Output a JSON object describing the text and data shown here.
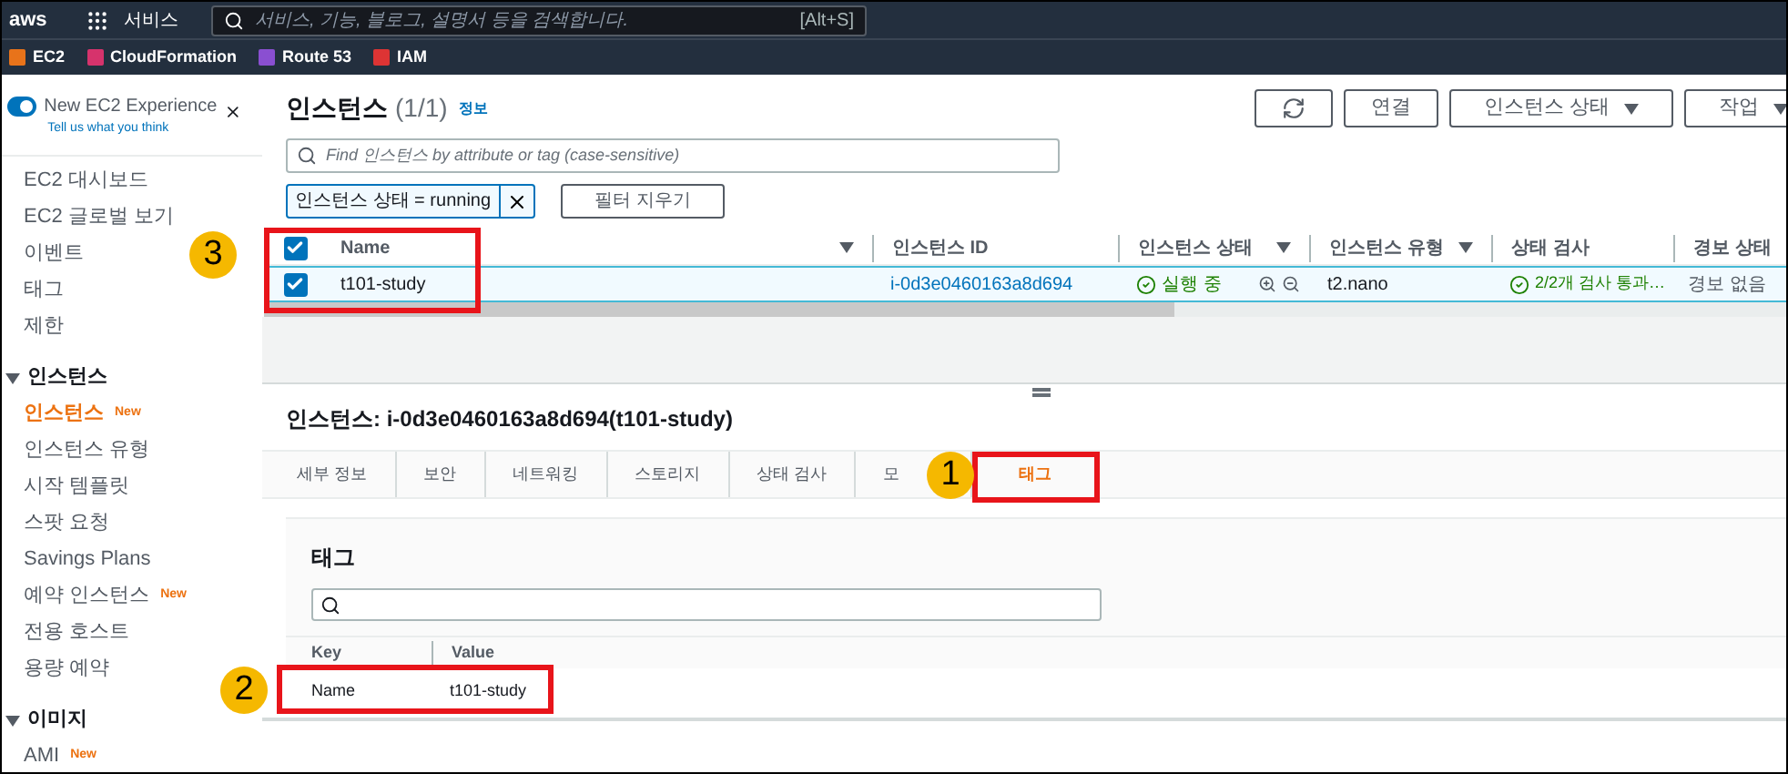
{
  "top_bar": {
    "logo": "aws",
    "services": "서비스",
    "search_placeholder": "서비스, 기능, 블로그, 설명서 등을 검색합니다.",
    "shortcut": "[Alt+S]"
  },
  "favorites": [
    {
      "label": "EC2",
      "color": "#e8731a"
    },
    {
      "label": "CloudFormation",
      "color": "#d6336c"
    },
    {
      "label": "Route 53",
      "color": "#8a4fd1"
    },
    {
      "label": "IAM",
      "color": "#dd3434"
    }
  ],
  "sidebar": {
    "experience": {
      "label": "New EC2 Experience",
      "link": "Tell us what you think",
      "on": true
    },
    "items": [
      {
        "label": "EC2 대시보드",
        "selected": false
      },
      {
        "label": "EC2 글로벌 보기",
        "selected": false
      },
      {
        "label": "이벤트",
        "selected": false
      },
      {
        "label": "태그",
        "selected": false
      },
      {
        "label": "제한",
        "selected": false
      }
    ],
    "sections": [
      {
        "title": "인스턴스",
        "expanded": true,
        "items": [
          {
            "label": "인스턴스",
            "selected": true,
            "badge": "New"
          },
          {
            "label": "인스턴스 유형",
            "selected": false
          },
          {
            "label": "시작 템플릿",
            "selected": false
          },
          {
            "label": "스팟 요청",
            "selected": false
          },
          {
            "label": "Savings Plans",
            "selected": false
          },
          {
            "label": "예약 인스턴스",
            "selected": false,
            "badge": "New"
          },
          {
            "label": "전용 호스트",
            "selected": false
          },
          {
            "label": "용량 예약",
            "selected": false
          }
        ]
      },
      {
        "title": "이미지",
        "expanded": true,
        "items": [
          {
            "label": "AMI",
            "selected": false,
            "badge": "New"
          }
        ]
      }
    ]
  },
  "instances": {
    "title": "인스턴스",
    "count": "(1/1)",
    "info": "정보",
    "buttons": [
      {
        "kind": "refresh"
      },
      {
        "label": "연결",
        "kind": "plain"
      },
      {
        "label": "인스턴스 상태",
        "kind": "dropdown"
      },
      {
        "label": "작업",
        "kind": "dropdown"
      }
    ],
    "search_placeholder": "Find 인스턴스 by attribute or tag (case-sensitive)",
    "filter_token": "인스턴스 상태 = running",
    "clear_filters": "필터 지우기"
  },
  "table": {
    "all_checked": true,
    "columns": [
      {
        "label": "Name",
        "sortable": true
      },
      {
        "label": "인스턴스 ID",
        "sortable": false
      },
      {
        "label": "인스턴스 상태",
        "sortable": true
      },
      {
        "label": "인스턴스 유형",
        "sortable": true
      },
      {
        "label": "상태 검사",
        "sortable": false
      },
      {
        "label": "경보 상태",
        "sortable": false
      }
    ],
    "rows": [
      {
        "selected": true,
        "name": "t101-study",
        "id": "i-0d3e0460163a8d694",
        "state": "실행 중",
        "type": "t2.nano",
        "checks": "2/2개 검사 통과…",
        "alarm": "경보 없음"
      }
    ]
  },
  "detail": {
    "title": "인스턴스: i-0d3e0460163a8d694(t101-study)",
    "tabs": [
      {
        "label": "세부 정보",
        "selected": false
      },
      {
        "label": "보안",
        "selected": false
      },
      {
        "label": "네트워킹",
        "selected": false
      },
      {
        "label": "스토리지",
        "selected": false
      },
      {
        "label": "상태 검사",
        "selected": false
      },
      {
        "label": "모",
        "selected": false
      },
      {
        "label": "태그",
        "selected": true
      }
    ],
    "tags": {
      "title": "태그",
      "columns": [
        "Key",
        "Value"
      ],
      "rows": [
        {
          "key": "Name",
          "value": "t101-study"
        }
      ]
    }
  },
  "annotations": [
    {
      "label": "3",
      "kind": "table"
    },
    {
      "label": "1",
      "kind": "tab"
    },
    {
      "label": "2",
      "kind": "tag"
    }
  ]
}
